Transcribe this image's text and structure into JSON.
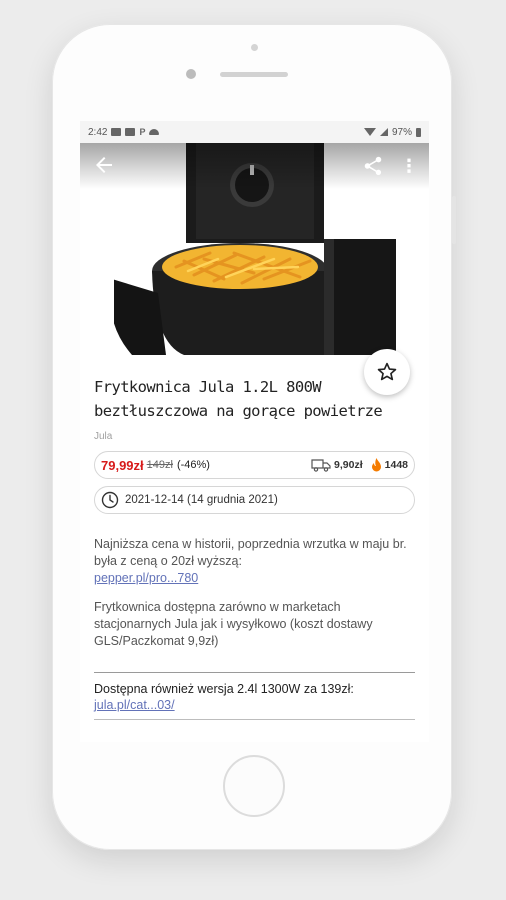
{
  "status_bar": {
    "time": "2:42",
    "battery": "97%"
  },
  "product": {
    "title_line1": "Frytkownica Jula 1.2L 800W",
    "title_line2": "beztłuszczowa na gorące powietrze",
    "merchant": "Jula",
    "price": "79,99zł",
    "old_price": "149zł",
    "discount": "(-46%)",
    "shipping": "9,90zł",
    "temperature": "1448",
    "date": "2021-12-14 (14 grudnia 2021)"
  },
  "description": {
    "para1_text": "Najniższa cena w historii, poprzednia wrzutka w maju br. była z ceną o 20zł wyższą:",
    "para1_link": "pepper.pl/pro...780",
    "para2_text": "Frytkownica dostępna zarówno w marketach stacjonarnych Jula jak i wysyłkowo (koszt dostawy GLS/Paczkomat 9,9zł)",
    "also_text": "Dostępna również wersja 2.4l 1300W za 139zł:",
    "also_link": "jula.pl/cat...03/"
  },
  "icons": {
    "back": "back-arrow-icon",
    "share": "share-icon",
    "more": "more-vert-icon",
    "star": "star-outline-icon",
    "shipping": "truck-icon",
    "temperature": "flame-icon",
    "clock": "clock-icon"
  },
  "colors": {
    "price": "#d71a1a",
    "link": "#6272b8",
    "flame": "#f57c00"
  }
}
